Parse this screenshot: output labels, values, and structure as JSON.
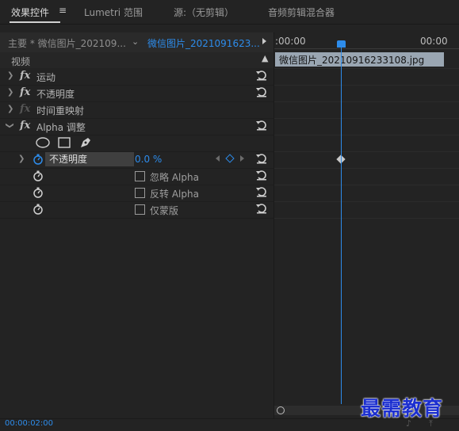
{
  "tabs": [
    {
      "label": "效果控件",
      "active": true
    },
    {
      "label": "Lumetri 范围"
    },
    {
      "label": "源:（无剪辑）"
    },
    {
      "label": "音频剪辑混合器"
    }
  ],
  "header": {
    "master_label": "主要 * 微信图片_202109...",
    "clip_label": "微信图片_2021091623..."
  },
  "section": {
    "video": "视频"
  },
  "effects": {
    "motion": "运动",
    "opacity": "不透明度",
    "time_remap": "时间重映射",
    "alpha_adjust": "Alpha 调整"
  },
  "alpha_params": {
    "opacity_label": "不透明度",
    "opacity_value": "0.0 %",
    "ignore_alpha": "忽略 Alpha",
    "invert_alpha": "反转 Alpha",
    "mask_only": "仅蒙版"
  },
  "timeline": {
    "start_time": ":00:00",
    "end_time": "00:00",
    "clip_name": "微信图片_20210916233108.jpg"
  },
  "footer": {
    "timecode": "00:00:02:00"
  },
  "watermark": "最需教育",
  "colors": {
    "accent": "#2d8ceb",
    "clip_bar": "#9aa6b2",
    "panel_bg": "#232323"
  }
}
